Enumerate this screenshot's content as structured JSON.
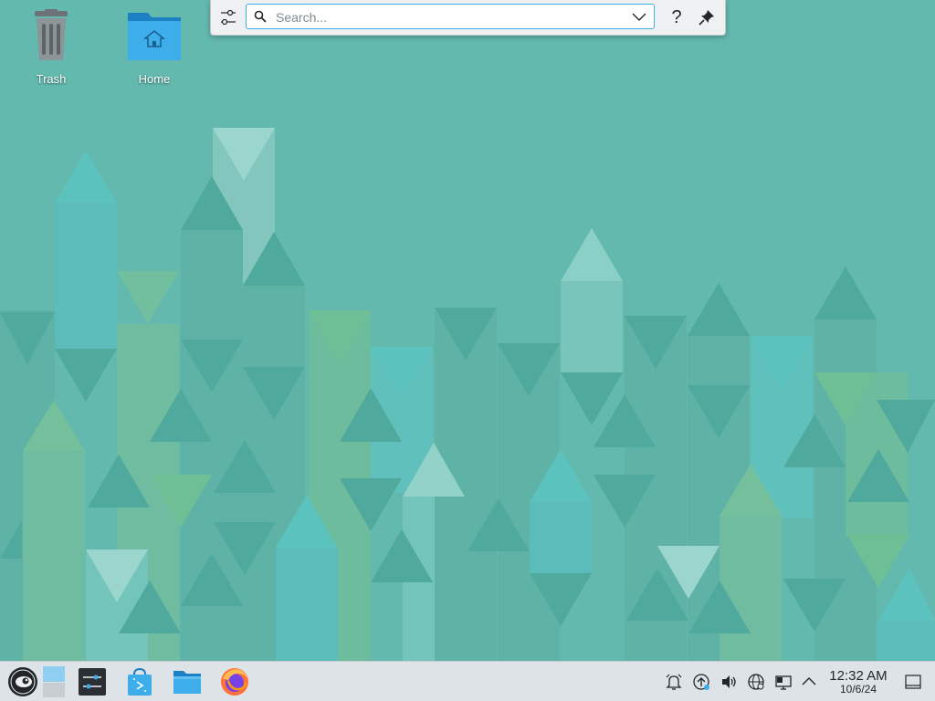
{
  "desktop": {
    "icons": [
      {
        "label": "Trash",
        "icon": "trash-icon"
      },
      {
        "label": "Home",
        "icon": "home-folder-icon"
      }
    ]
  },
  "krunner": {
    "search_placeholder": "Search...",
    "search_value": "",
    "help_label": "?",
    "icons": [
      "configure-icon",
      "search-icon",
      "chevron-down-icon",
      "pin-icon"
    ]
  },
  "taskbar": {
    "launchers": [
      "application-launcher-icon",
      "pager-icon",
      "system-settings-icon",
      "discover-icon",
      "file-manager-icon",
      "firefox-icon"
    ],
    "tray": [
      "notifications-icon",
      "updates-icon",
      "volume-icon",
      "network-icon",
      "display-icon",
      "expand-tray-icon"
    ],
    "clock": {
      "time": "12:32 AM",
      "date": "10/6/24"
    }
  },
  "colors": {
    "wallpaper": "#63b9ae",
    "panel": "#dde3e7",
    "accent": "#3daee9"
  }
}
